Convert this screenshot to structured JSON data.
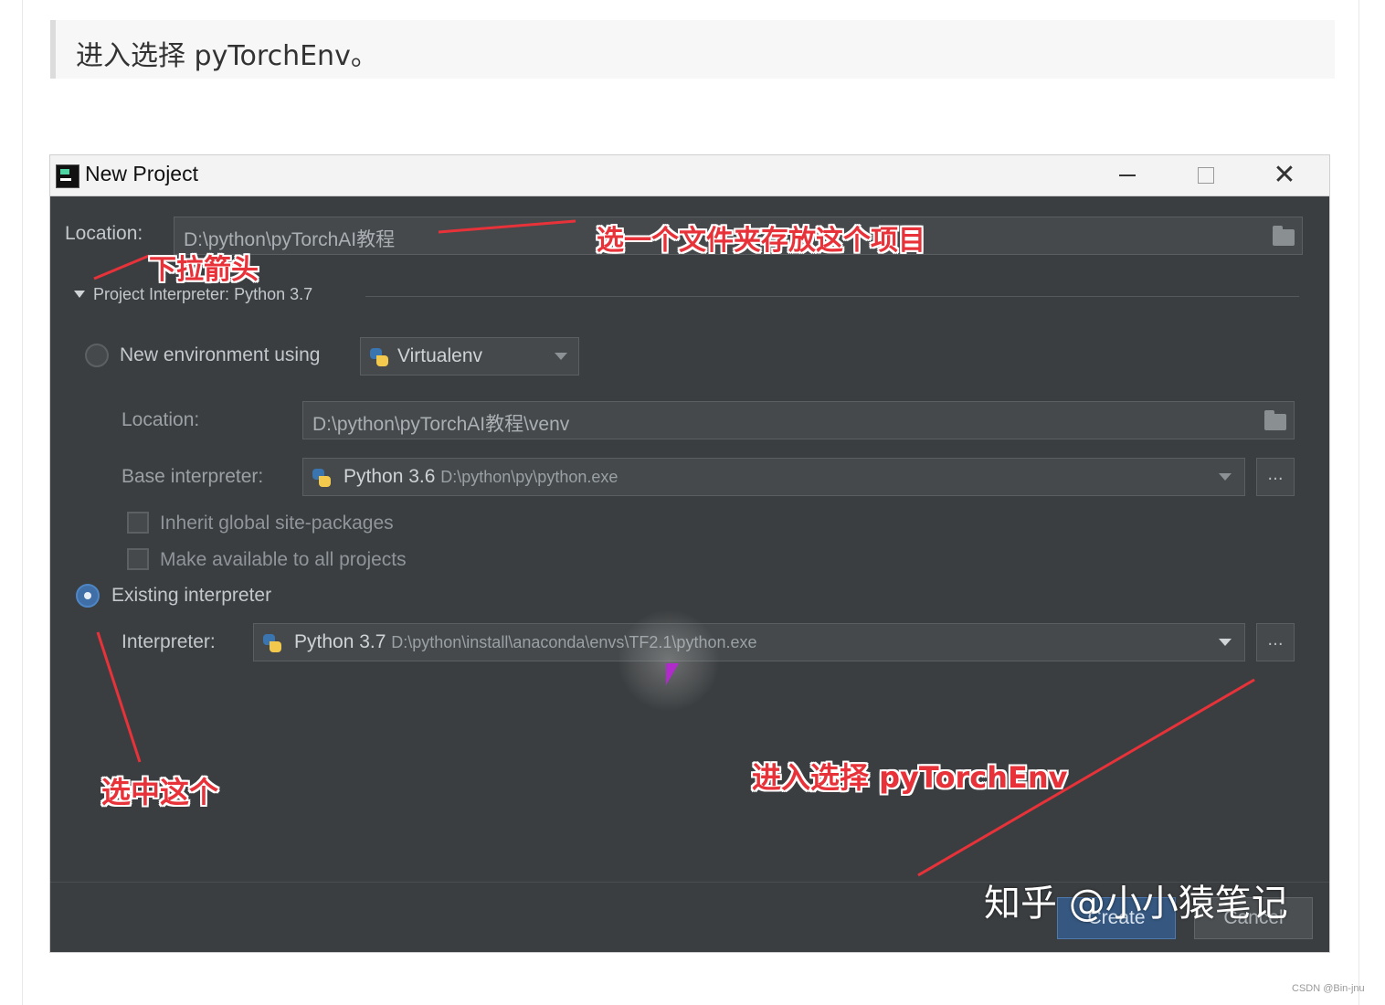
{
  "article": {
    "quote_text": "进入选择 pyTorchEnv。"
  },
  "dialog": {
    "title": "New Project",
    "project_location_label": "Location:",
    "project_location_value": "D:\\python\\pyTorchAI教程",
    "interpreter_section_label": "Project Interpreter: Python 3.7",
    "new_env_label": "New environment using",
    "new_env_tool": "Virtualenv",
    "venv_location_label": "Location:",
    "venv_location_value": "D:\\python\\pyTorchAI教程\\venv",
    "base_interpreter_label": "Base interpreter:",
    "base_interpreter_name": "Python 3.6",
    "base_interpreter_path": "D:\\python\\py\\python.exe",
    "inherit_label": "Inherit global site-packages",
    "make_available_label": "Make available to all projects",
    "existing_label": "Existing interpreter",
    "interpreter_label": "Interpreter:",
    "interpreter_name": "Python 3.7",
    "interpreter_path": "D:\\python\\install\\anaconda\\envs\\TF2.1\\python.exe",
    "browse_label": "...",
    "create_label": "Create",
    "cancel_label": "Cancel"
  },
  "annotations": {
    "folder_note": "选一个文件夹存放这个项目",
    "dropdown_note": "下拉箭头",
    "select_note": "选中这个",
    "env_note": "进入选择 pyTorchEnv"
  },
  "watermark": "知乎 @小小猿笔记",
  "csdn_credit": "CSDN @Bin-jnu",
  "colors": {
    "dialog_bg": "#3b3e40",
    "annotation_red": "#e8323a",
    "primary_button": "#365880"
  }
}
